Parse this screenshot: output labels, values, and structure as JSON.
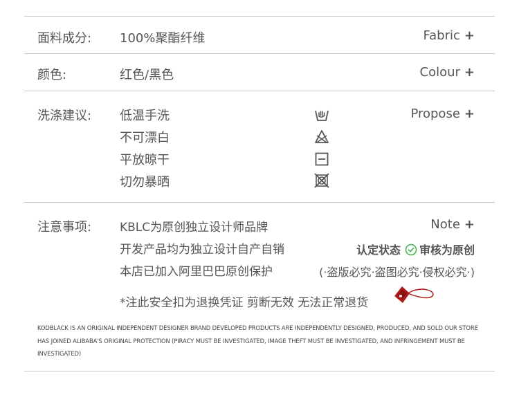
{
  "rows": {
    "fabric": {
      "label": "面料成分:",
      "value": "100%聚酯纤维",
      "right": "Fabric",
      "plus": "+"
    },
    "colour": {
      "label": "颜色:",
      "value": "红色/黑色",
      "right": "Colour",
      "plus": "+"
    },
    "care": {
      "label": "洗涤建议:",
      "right": "Propose",
      "plus": "+",
      "items": [
        {
          "text": "低温手洗",
          "icon": "hand-wash-icon"
        },
        {
          "text": "不可漂白",
          "icon": "no-bleach-icon"
        },
        {
          "text": "平放晾干",
          "icon": "dry-flat-icon"
        },
        {
          "text": "切勿暴晒",
          "icon": "no-sun-dry-icon"
        }
      ]
    },
    "note": {
      "label": "注意事项:",
      "right": "Note",
      "plus": "+",
      "lines": [
        "KBLC为原创独立设计师品牌",
        "开发产品均为独立设计自产自销",
        "本店已加入阿里巴巴原创保护"
      ],
      "cert_left": "认定状态",
      "cert_right": "审核为原创",
      "protect": "(·盗版必究·盗图必究·侵权必究·)",
      "tag_notice": "*注此安全扣为退换凭证 剪断无效 无法正常退货"
    }
  },
  "footer": "KODBLACK IS AN ORIGINAL INDEPENDENT DESIGNER BRAND DEVELOPED PRODUCTS ARE INDEPENDENTLY DESIGNED, PRODUCED, AND SOLD OUR STORE HAS JOINED ALIBABA'S ORIGINAL PROTECTION (PIRACY MUST BE INVESTIGATED, IMAGE THEFT MUST BE INVESTIGATED, AND INFRINGEMENT MUST BE INVESTIGATED)",
  "colors": {
    "text": "#555555",
    "rule": "#c8c8c8",
    "check": "#3cb44b",
    "tag": "#b01c1c"
  }
}
